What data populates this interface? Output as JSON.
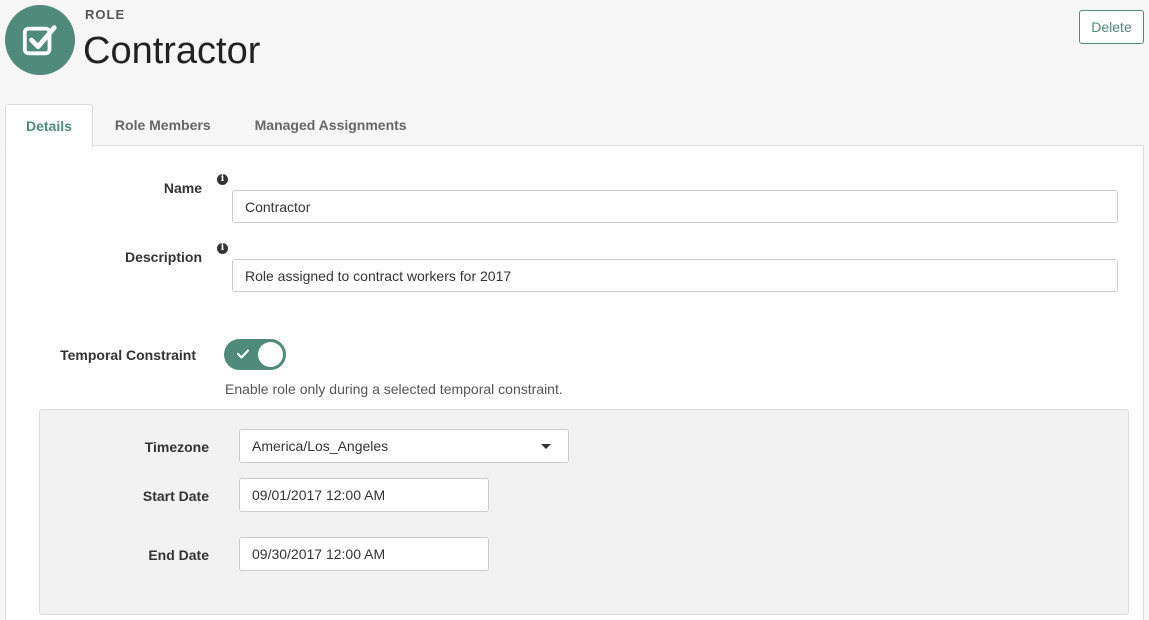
{
  "header": {
    "kicker": "ROLE",
    "title": "Contractor",
    "delete_label": "Delete",
    "avatar_icon": "checkbox-icon"
  },
  "tabs": [
    {
      "label": "Details",
      "active": true
    },
    {
      "label": "Role Members",
      "active": false
    },
    {
      "label": "Managed Assignments",
      "active": false
    }
  ],
  "details": {
    "name_label": "Name",
    "name_value": "Contractor",
    "description_label": "Description",
    "description_value": "Role assigned to contract workers for 2017",
    "temporal_label": "Temporal Constraint",
    "temporal_enabled": true,
    "temporal_help": "Enable role only during a selected temporal constraint."
  },
  "temporal": {
    "timezone_label": "Timezone",
    "timezone_value": "America/Los_Angeles",
    "start_label": "Start Date",
    "start_value": "09/01/2017 12:00 AM",
    "end_label": "End Date",
    "end_value": "09/30/2017 12:00 AM"
  },
  "colors": {
    "accent": "#4f8a7a",
    "background": "#f6f6f6"
  }
}
